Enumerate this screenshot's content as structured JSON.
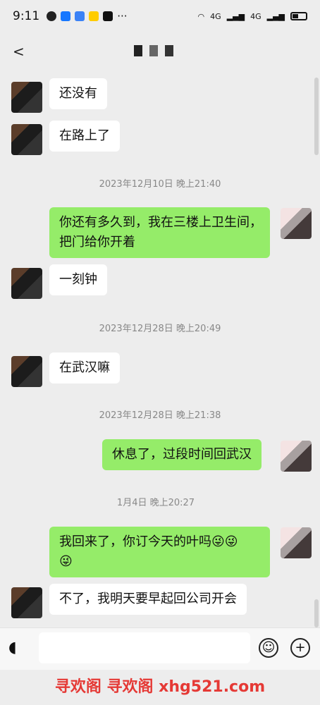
{
  "status": {
    "time": "9:11",
    "network1": "4G",
    "network2": "4G"
  },
  "nav": {
    "back_icon": "back-icon"
  },
  "messages": [
    {
      "text": "还没有"
    },
    {
      "text": "在路上了"
    },
    {
      "timestamp": "2023年12月10日 晚上21:40"
    },
    {
      "text_line1": "你还有多久到，我在三楼上卫生间，",
      "text_line2": "把门给你开着"
    },
    {
      "text": "一刻钟"
    },
    {
      "timestamp": "2023年12月28日 晚上20:49"
    },
    {
      "text": "在武汉嘛"
    },
    {
      "timestamp": "2023年12月28日 晚上21:38"
    },
    {
      "text": "休息了，过段时间回武汉"
    },
    {
      "timestamp": "1月4日 晚上20:27"
    },
    {
      "text_line1": "我回来了，你订今天的叶吗😜😜",
      "text_line2": "😜"
    },
    {
      "text": "不了，我明天要早起回公司开会"
    }
  ],
  "watermark": "寻欢阁 寻欢阁 xhg521.com"
}
